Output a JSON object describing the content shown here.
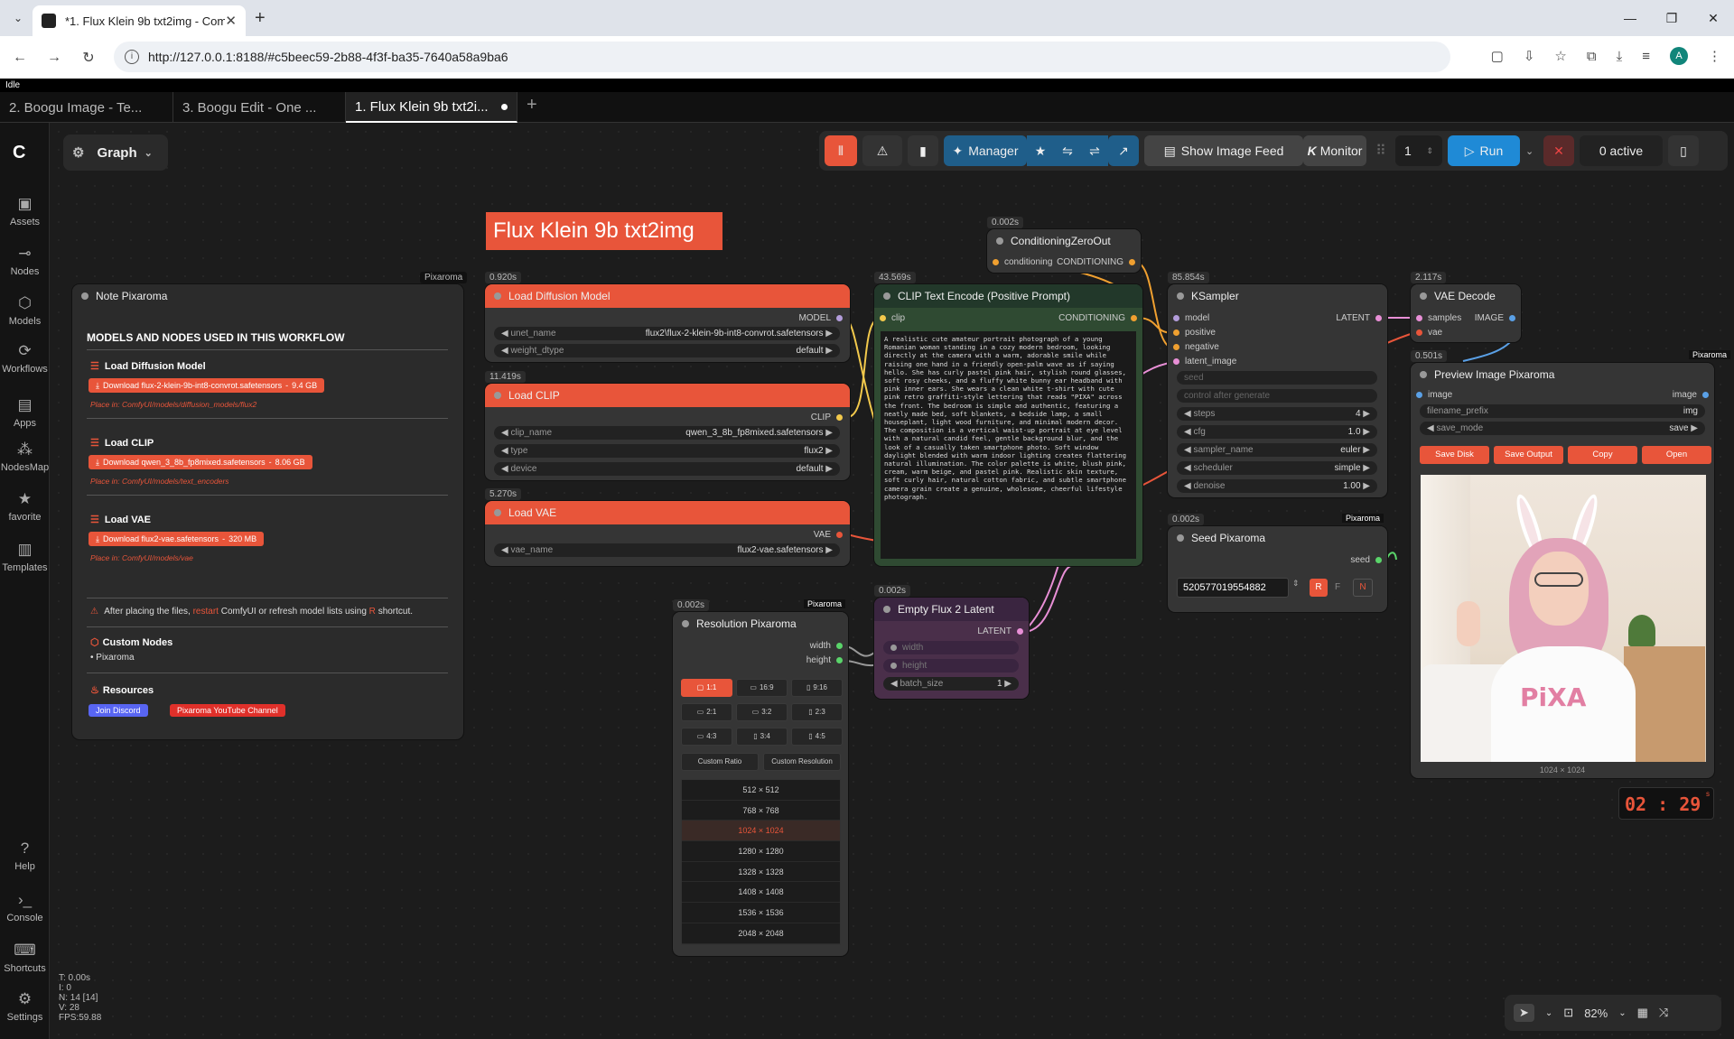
{
  "browser": {
    "tab_title": "*1. Flux Klein 9b txt2img - Com",
    "url": "http://127.0.0.1:8188/#c5beec59-2b88-4f3f-ba35-7640a58a9ba6",
    "avatar": "A"
  },
  "app": {
    "status": "Idle",
    "workflow_tabs": [
      "2. Boogu Image - Te...",
      "3. Boogu Edit - One ...",
      "1. Flux Klein 9b txt2i..."
    ],
    "graph_label": "Graph",
    "sidebar": [
      {
        "label": "Assets",
        "icon": "image-icon"
      },
      {
        "label": "Nodes",
        "icon": "node-icon"
      },
      {
        "label": "Models",
        "icon": "cube-icon"
      },
      {
        "label": "Workflows",
        "icon": "workflow-icon"
      },
      {
        "label": "Apps",
        "icon": "apps-icon"
      },
      {
        "label": "NodesMap",
        "icon": "map-icon"
      },
      {
        "label": "favorite",
        "icon": "star-icon"
      },
      {
        "label": "Templates",
        "icon": "template-icon"
      }
    ],
    "sidebar_bottom": [
      {
        "label": "Help",
        "icon": "help-icon"
      },
      {
        "label": "Console",
        "icon": "console-icon"
      },
      {
        "label": "Shortcuts",
        "icon": "keyboard-icon"
      },
      {
        "label": "Settings",
        "icon": "gear-icon"
      }
    ],
    "toolbar": {
      "manager": "Manager",
      "show_feed": "Show Image Feed",
      "monitor": "Monitor",
      "batch": "1",
      "run": "Run",
      "active": "0 active"
    },
    "stats": [
      "T: 0.00s",
      "I: 0",
      "N: 14 [14]",
      "V: 28",
      "FPS:59.88"
    ],
    "zoom": "82%",
    "timer": "02 : 29",
    "timer_unit": "s"
  },
  "workflow_title": "Flux Klein 9b txt2img",
  "note": {
    "tag": "Pixaroma",
    "title": "Note Pixaroma",
    "heading": "MODELS AND NODES USED IN THIS WORKFLOW",
    "sections": [
      {
        "name": "Load Diffusion Model",
        "download": "Download flux-2-klein-9b-int8-convrot.safetensors",
        "size": "9.4 GB",
        "place": "Place in: ComfyUI/models/diffusion_models/flux2"
      },
      {
        "name": "Load CLIP",
        "download": "Download qwen_3_8b_fp8mixed.safetensors",
        "size": "8.06 GB",
        "place": "Place in: ComfyUI/models/text_encoders"
      },
      {
        "name": "Load VAE",
        "download": "Download flux2-vae.safetensors",
        "size": "320 MB",
        "place": "Place in: ComfyUI/models/vae"
      }
    ],
    "warn_a": "After placing the files,",
    "warn_b": "restart",
    "warn_c": "ComfyUI or refresh model lists using",
    "warn_d": "R",
    "warn_e": "shortcut.",
    "custom_nodes_title": "Custom Nodes",
    "custom_nodes": "Pixaroma",
    "resources_title": "Resources",
    "discord": "Join Discord",
    "youtube": "Pixaroma YouTube Channel"
  },
  "nodes": {
    "load_model": {
      "time": "0.920s",
      "title": "Load Diffusion Model",
      "out": "MODEL",
      "w1l": "unet_name",
      "w1v": "flux2\\flux-2-klein-9b-int8-convrot.safetensors",
      "w2l": "weight_dtype",
      "w2v": "default"
    },
    "load_clip": {
      "time": "11.419s",
      "title": "Load CLIP",
      "out": "CLIP",
      "w1l": "clip_name",
      "w1v": "qwen_3_8b_fp8mixed.safetensors",
      "w2l": "type",
      "w2v": "flux2",
      "w3l": "device",
      "w3v": "default"
    },
    "load_vae": {
      "time": "5.270s",
      "title": "Load VAE",
      "out": "VAE",
      "w1l": "vae_name",
      "w1v": "flux2-vae.safetensors"
    },
    "clip_text": {
      "time": "43.569s",
      "title": "CLIP Text Encode (Positive Prompt)",
      "in": "clip",
      "out": "CONDITIONING",
      "prompt": "A realistic cute amateur portrait photograph of a young Romanian woman standing in a cozy modern bedroom, looking directly at the camera with a warm, adorable smile while raising one hand in a friendly open-palm wave as if saying hello. She has curly pastel pink hair, stylish round glasses, soft rosy cheeks, and a fluffy white bunny ear headband with pink inner ears. She wears a clean white t-shirt with cute pink retro graffiti-style lettering that reads \"PIXA\" across the front. The bedroom is simple and authentic, featuring a neatly made bed, soft blankets, a bedside lamp, a small houseplant, light wood furniture, and minimal modern decor. The composition is a vertical waist-up portrait at eye level with a natural candid feel, gentle background blur, and the look of a casually taken smartphone photo. Soft window daylight blended with warm indoor lighting creates flattering natural illumination. The color palette is white, blush pink, cream, warm beige, and pastel pink. Realistic skin texture, soft curly hair, natural cotton fabric, and subtle smartphone camera grain create a genuine, wholesome, cheerful lifestyle photograph."
    },
    "cond_zero": {
      "time": "0.002s",
      "title": "ConditioningZeroOut",
      "in": "conditioning",
      "out": "CONDITIONING"
    },
    "ksampler": {
      "time": "85.854s",
      "title": "KSampler",
      "in": [
        "model",
        "positive",
        "negative",
        "latent_image"
      ],
      "out": "LATENT",
      "seed": "seed",
      "control": "control after generate",
      "widgets": [
        [
          "steps",
          "4"
        ],
        [
          "cfg",
          "1.0"
        ],
        [
          "sampler_name",
          "euler"
        ],
        [
          "scheduler",
          "simple"
        ],
        [
          "denoise",
          "1.00"
        ]
      ]
    },
    "vae_decode": {
      "time": "2.117s",
      "title": "VAE Decode",
      "in": [
        "samples",
        "vae"
      ],
      "out": "IMAGE"
    },
    "preview": {
      "time": "0.501s",
      "tag": "Pixaroma",
      "title": "Preview Image Pixaroma",
      "in": "image",
      "out": "image",
      "w1l": "filename_prefix",
      "w1v": "img",
      "w2l": "save_mode",
      "w2v": "save",
      "buttons": [
        "Save Disk",
        "Save Output",
        "Copy",
        "Open"
      ],
      "size": "1024 × 1024",
      "shirt": "PiXA"
    },
    "seed": {
      "time": "0.002s",
      "tag": "Pixaroma",
      "title": "Seed Pixaroma",
      "out": "seed",
      "value": "520577019554882",
      "r": "R",
      "f": "F",
      "n": "N"
    },
    "empty_latent": {
      "time": "0.002s",
      "title": "Empty Flux 2 Latent",
      "out": "LATENT",
      "w1": "width",
      "w2": "height",
      "w3l": "batch_size",
      "w3v": "1"
    },
    "resolution": {
      "time": "0.002s",
      "tag": "Pixaroma",
      "title": "Resolution Pixaroma",
      "outs": [
        "width",
        "height"
      ],
      "ratios": [
        "1:1",
        "16:9",
        "9:16",
        "2:1",
        "3:2",
        "2:3",
        "4:3",
        "3:4",
        "4:5"
      ],
      "custom": [
        "Custom Ratio",
        "Custom Resolution"
      ],
      "sizes": [
        "512 × 512",
        "768 × 768",
        "1024 × 1024",
        "1280 × 1280",
        "1328 × 1328",
        "1408 × 1408",
        "1536 × 1536",
        "2048 × 2048"
      ]
    }
  }
}
